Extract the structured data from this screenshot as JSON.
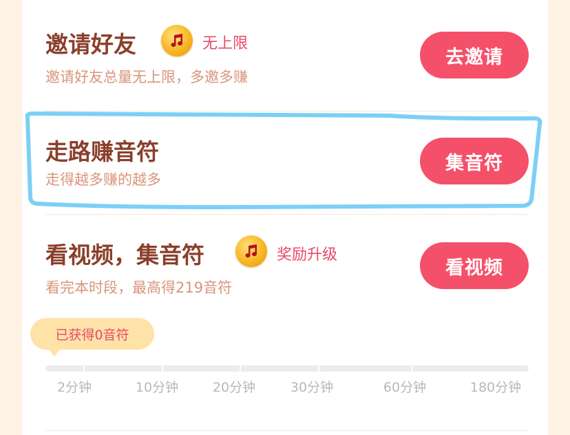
{
  "tasks": [
    {
      "title": "邀请好友",
      "tag": "无上限",
      "subtitle": "邀请好友总量无上限，多邀多赚",
      "button": "去邀请"
    },
    {
      "title": "走路赚音符",
      "subtitle": "走得越多赚的越多",
      "button": "集音符"
    },
    {
      "title": "看视频，集音符",
      "tag": "奖励升级",
      "subtitle": "看完本时段，最高得219音符",
      "button": "看视频"
    }
  ],
  "progress": {
    "earned_label": "已获得0音符",
    "value_fraction": 0,
    "ticks": [
      "2分钟",
      "10分钟",
      "20分钟",
      "30分钟",
      "60分钟",
      "180分钟"
    ]
  },
  "colors": {
    "accent": "#f5506a",
    "title": "#8a3f2b",
    "highlight_outline": "#7dcff5"
  },
  "icons": {
    "coin": "music-note-coin-icon"
  }
}
